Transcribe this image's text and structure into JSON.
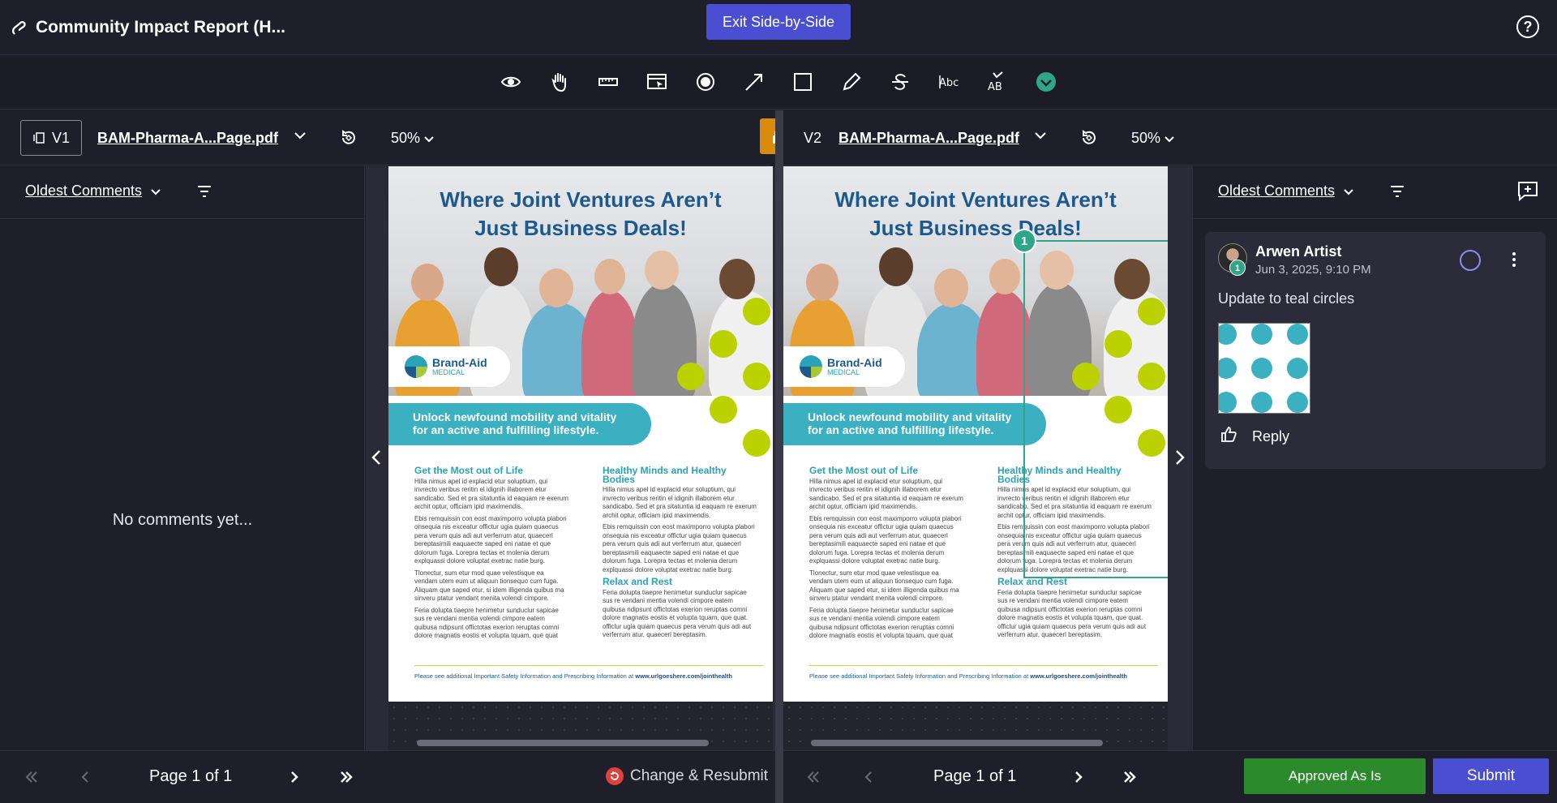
{
  "header": {
    "title": "Community Impact Report (H...",
    "exit_label": "Exit Side-by-Side",
    "help_icon": "?"
  },
  "toolbar": {
    "tools": [
      "eye-icon",
      "hand-icon",
      "ruler-icon",
      "select-area-icon",
      "record-icon",
      "arrow-icon",
      "rectangle-icon",
      "pencil-icon",
      "strikethrough-icon",
      "text-replace-icon",
      "spellcheck-icon",
      "check-circle-icon"
    ]
  },
  "left_version": {
    "badge": "V1",
    "filename": "BAM-Pharma-A...Page.pdf",
    "zoom": "50%"
  },
  "right_version": {
    "badge": "V2",
    "filename": "BAM-Pharma-A...Page.pdf",
    "zoom": "50%"
  },
  "left_comments": {
    "sort_label": "Oldest Comments",
    "empty_text": "No comments yet..."
  },
  "right_comments": {
    "sort_label": "Oldest Comments"
  },
  "document": {
    "title_line1": "Where Joint Ventures Aren’t",
    "title_line2": "Just Business Deals!",
    "brand_name": "Brand-Aid",
    "brand_sub": "MEDICAL",
    "banner_line1": "Unlock newfound mobility and vitality",
    "banner_line2": "for an active and fulfilling lifestyle.",
    "col1_heading": "Get the Most out of Life",
    "col1_p1": "Hilla nimus apel id explacid etur soluptium, qui invrecto veribus reritin el idignih illaborem etur sandicabo. Sed et pra sitatuntia id eaquam re exerum archit optur, officiam ipid maximendis.",
    "col1_p2": "Ebis remquissin con eost maximporro volupta plabori onsequia nis exceatur offictur ugia quiam quaecus pera verum quis adi aut verferrum atur, quaecerl bereptasimili eaquaecte saped eni natae et que dolorum fuga. Lorepra tectas et molenia derum explquassi dolore voluptat exetrac natie burg.",
    "col1_p3": "Tlonectur, sum etur mod quae velestisque ea vendam utem eum ut aliquun tionsequo cum fuga. Aliquam que saped etur, si idem illigenda quibus ma sinveru ptatur vendant menita volendi cimpore.",
    "col1_p4": "Feria dolupta tiaepre henimetur sunduclur sapicae sus re vendani mentia volendi cimpore eatem quibusa ndipsunt offictotas exerion reruptas comni dolore magnatis eostis et volupta tquam, que quat",
    "col2_heading": "Healthy Minds and Healthy Bodies",
    "col2_p1": "Hilla nimus apel id explacid etur soluptium, qui invrecto veribus reritin el idignih illaborem etur sandicabo. Sed et pra sitatuntia id eaquam re exerum archit optur, officiam ipid maximendis.",
    "col2_p2": "Ebis remquissin con eost maximporro volupta plabori onsequia nis exceatur offictur ugia quiam quaecus pera verum quis adi aut verferrum atur, quaecerl bereptasimili eaquaecte saped eni natae et que dolorum fuga. Lorepra tectas et molenia derum explquassi dolore voluptat exetrac natie burg.",
    "col2_heading2": "Relax and Rest",
    "col2_p3": "Feria dolupta tiaepre henimetur sunduclur sapicae sus re vendani mentia volendi cimpore eatem quibusa ndipsunt offictotas exerion reruptas comni dolore magnatis eostis et volupta tquam, que quat. officlur ugia quiam quaecus pera verum quis adi aut verferrum atur, quaecerl bereptasim.",
    "footer_text": "Please see additional Important Safety Information and Prescribing Information at ",
    "footer_url": "www.urlgoeshere.com/jointhealth"
  },
  "comment": {
    "author": "Arwen Artist",
    "badge": "1",
    "time": "Jun 3, 2025, 9:10 PM",
    "text": "Update to teal circles",
    "reply_label": "Reply",
    "pin_number": "1"
  },
  "pagination_left": {
    "label": "Page 1 of 1"
  },
  "pagination_right": {
    "label": "Page 1 of 1"
  },
  "actions": {
    "resubmit_label": "Change & Resubmit",
    "approve_label": "Approved As Is",
    "submit_label": "Submit"
  },
  "colors": {
    "accent": "#4a4fd1",
    "approve": "#2b8a2b",
    "lock": "#d98b0b",
    "annotation": "#2fa58a",
    "old_circle": "#bcd100",
    "new_circle": "#3bb0c0"
  }
}
